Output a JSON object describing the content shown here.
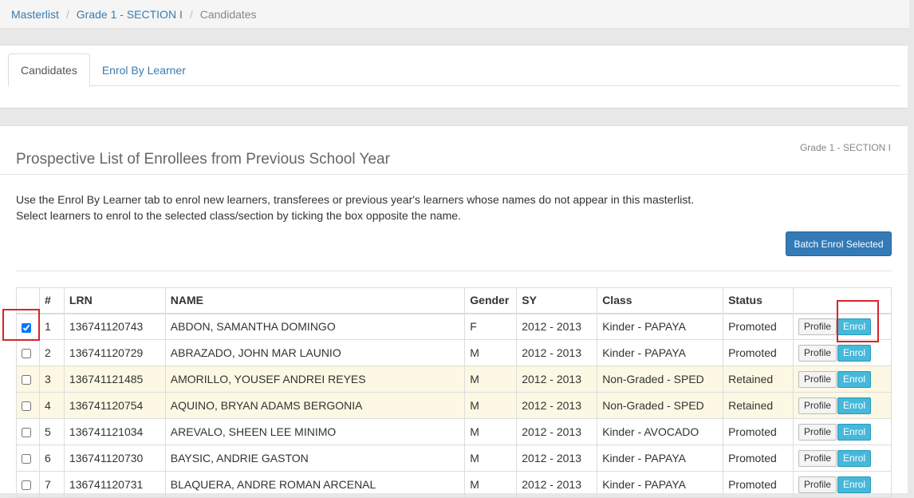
{
  "breadcrumb": {
    "items": [
      "Masterlist",
      "Grade 1 - SECTION I"
    ],
    "current": "Candidates",
    "separator": "/"
  },
  "tabs": [
    {
      "label": "Candidates",
      "active": true
    },
    {
      "label": "Enrol By Learner",
      "active": false
    }
  ],
  "panel": {
    "title": "Prospective List of Enrollees from Previous School Year",
    "section": "Grade 1 - SECTION I",
    "instructions": [
      "Use the Enrol By Learner tab to enrol new learners, transferees or previous year's learners whose names do not appear in this masterlist.",
      "Select learners to enrol to the selected class/section by ticking the box opposite the name."
    ],
    "batch_button": "Batch Enrol Selected"
  },
  "table": {
    "headers": [
      "",
      "#",
      "LRN",
      "NAME",
      "Gender",
      "SY",
      "Class",
      "Status",
      ""
    ],
    "profile_label": "Profile",
    "enrol_label": "Enrol",
    "rows": [
      {
        "checked": true,
        "num": "1",
        "lrn": "136741120743",
        "name": "ABDON, SAMANTHA DOMINGO",
        "gender": "F",
        "sy": "2012 - 2013",
        "class": "Kinder - PAPAYA",
        "status": "Promoted",
        "warn": false
      },
      {
        "checked": false,
        "num": "2",
        "lrn": "136741120729",
        "name": "ABRAZADO, JOHN MAR LAUNIO",
        "gender": "M",
        "sy": "2012 - 2013",
        "class": "Kinder - PAPAYA",
        "status": "Promoted",
        "warn": false
      },
      {
        "checked": false,
        "num": "3",
        "lrn": "136741121485",
        "name": "AMORILLO, YOUSEF ANDREI REYES",
        "gender": "M",
        "sy": "2012 - 2013",
        "class": "Non-Graded - SPED",
        "status": "Retained",
        "warn": true
      },
      {
        "checked": false,
        "num": "4",
        "lrn": "136741120754",
        "name": "AQUINO, BRYAN ADAMS BERGONIA",
        "gender": "M",
        "sy": "2012 - 2013",
        "class": "Non-Graded - SPED",
        "status": "Retained",
        "warn": true
      },
      {
        "checked": false,
        "num": "5",
        "lrn": "136741121034",
        "name": "AREVALO, SHEEN LEE MINIMO",
        "gender": "M",
        "sy": "2012 - 2013",
        "class": "Kinder - AVOCADO",
        "status": "Promoted",
        "warn": false
      },
      {
        "checked": false,
        "num": "6",
        "lrn": "136741120730",
        "name": "BAYSIC, ANDRIE GASTON",
        "gender": "M",
        "sy": "2012 - 2013",
        "class": "Kinder - PAPAYA",
        "status": "Promoted",
        "warn": false
      },
      {
        "checked": false,
        "num": "7",
        "lrn": "136741120731",
        "name": "BLAQUERA, ANDRE ROMAN ARCENAL",
        "gender": "M",
        "sy": "2012 - 2013",
        "class": "Kinder - PAPAYA",
        "status": "Promoted",
        "warn": false
      }
    ]
  },
  "colors": {
    "link": "#3c7bae",
    "primary_button": "#337ab7",
    "info_button": "#46b8da",
    "warning_row": "#fcf8e3",
    "annotation": "#d9232a"
  }
}
